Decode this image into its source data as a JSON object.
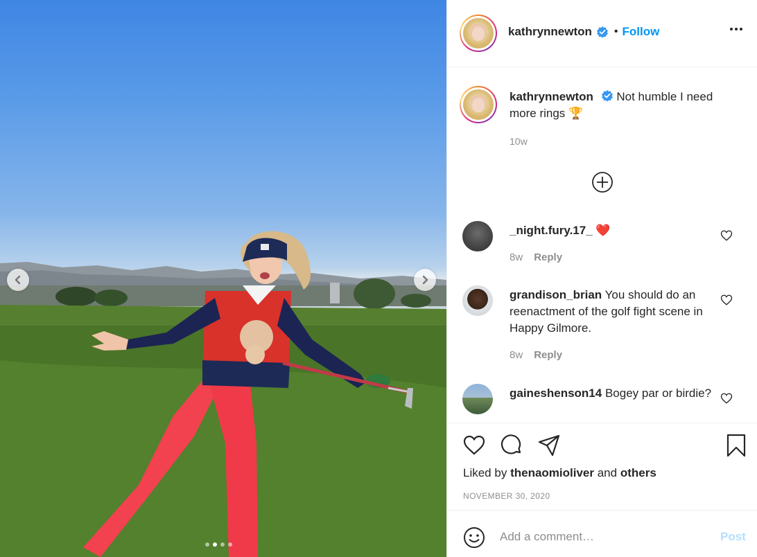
{
  "post": {
    "username": "kathrynnewton",
    "follow_label": "Follow",
    "bullet": "•",
    "caption": "Not humble I need more rings 🏆",
    "caption_time": "10w",
    "liked_by_prefix": "Liked by",
    "liked_by_user": "thenaomioliver",
    "liked_by_and": "and",
    "liked_by_others": "others",
    "date": "NOVEMBER 30, 2020",
    "carousel": {
      "slide_count": 4,
      "active_index": 1
    }
  },
  "comments": [
    {
      "username": "_night.fury.17_",
      "text": "❤️",
      "time": "8w",
      "reply_label": "Reply"
    },
    {
      "username": "grandison_brian",
      "text": "You should do an reenactment of the golf fight scene in Happy Gilmore.",
      "time": "8w",
      "reply_label": "Reply"
    },
    {
      "username": "gaineshenson14",
      "text": "Bogey par or birdie?"
    }
  ],
  "add_comment": {
    "placeholder": "Add a comment…",
    "post_label": "Post"
  },
  "colors": {
    "accent": "#0095f6",
    "text": "#262626",
    "muted": "#8e8e8e",
    "border": "#efefef",
    "post_disabled": "#b2dffc"
  },
  "icons": [
    "chevron-left-icon",
    "chevron-right-icon",
    "verified-badge-icon",
    "more-options-icon",
    "load-more-plus-icon",
    "heart-icon",
    "comment-icon",
    "share-icon",
    "bookmark-icon",
    "emoji-icon"
  ]
}
